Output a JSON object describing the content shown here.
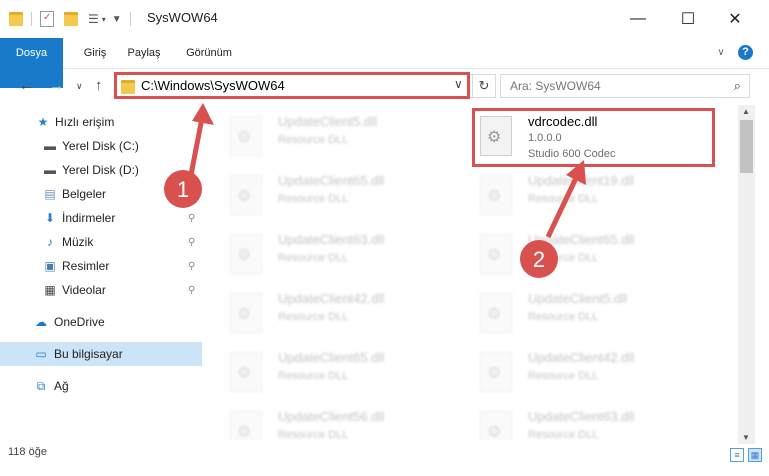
{
  "window": {
    "title": "SysWOW64",
    "minimize": "—",
    "maximize": "☐",
    "close": "✕"
  },
  "ribbon": {
    "tabs": [
      "Dosya",
      "Giriş",
      "Paylaş",
      "Görünüm"
    ],
    "collapse_icon": "∨",
    "help_icon": "?"
  },
  "nav": {
    "back": "←",
    "forward": "→",
    "recent": "∨",
    "up": "↑"
  },
  "address": {
    "path": "C:\\Windows\\SysWOW64",
    "dropdown": "∨",
    "refresh": "↻"
  },
  "search": {
    "placeholder": "Ara: SysWOW64",
    "icon": "⌕"
  },
  "sidebar": {
    "items": [
      {
        "label": "Hızlı erişim",
        "icon": "★",
        "pinned": false
      },
      {
        "label": "Yerel Disk (C:)",
        "icon": "▬",
        "pinned": true
      },
      {
        "label": "Yerel Disk (D:)",
        "icon": "▬",
        "pinned": true
      },
      {
        "label": "Belgeler",
        "icon": "▤",
        "pinned": true
      },
      {
        "label": "İndirmeler",
        "icon": "⬇",
        "pinned": true
      },
      {
        "label": "Müzik",
        "icon": "♪",
        "pinned": true
      },
      {
        "label": "Resimler",
        "icon": "▣",
        "pinned": true
      },
      {
        "label": "Videolar",
        "icon": "▦",
        "pinned": true
      },
      {
        "label": "OneDrive",
        "icon": "☁",
        "pinned": false
      },
      {
        "label": "Bu bilgisayar",
        "icon": "▭",
        "pinned": false
      },
      {
        "label": "Ağ",
        "icon": "⧉",
        "pinned": false
      }
    ],
    "pin_icon": "⚲"
  },
  "files": {
    "highlighted": {
      "name": "vdrcodec.dll",
      "version": "1.0.0.0",
      "desc": "Studio 600 Codec"
    },
    "left": [
      {
        "name": "UpdateClient5.dll",
        "desc": "Resource DLL"
      },
      {
        "name": "UpdateClient65.dll",
        "desc": "Resource DLL"
      },
      {
        "name": "UpdateClient63.dll",
        "desc": "Resource DLL"
      },
      {
        "name": "UpdateClient42.dll",
        "desc": "Resource DLL"
      },
      {
        "name": "UpdateClient65.dll",
        "desc": "Resource DLL"
      },
      {
        "name": "UpdateClient56.dll",
        "desc": "Resource DLL"
      }
    ],
    "right": [
      {
        "name": "UpdateClient19.dll",
        "desc": "Resource DLL"
      },
      {
        "name": "UpdateClient65.dll",
        "desc": "Resource DLL"
      },
      {
        "name": "UpdateClient5.dll",
        "desc": "Resource DLL"
      },
      {
        "name": "UpdateClient42.dll",
        "desc": "Resource DLL"
      },
      {
        "name": "UpdateClient63.dll",
        "desc": "Resource DLL"
      }
    ]
  },
  "status": {
    "count": "118 öğe"
  },
  "annotations": {
    "badge1": "1",
    "badge2": "2",
    "color": "#d9514f"
  }
}
